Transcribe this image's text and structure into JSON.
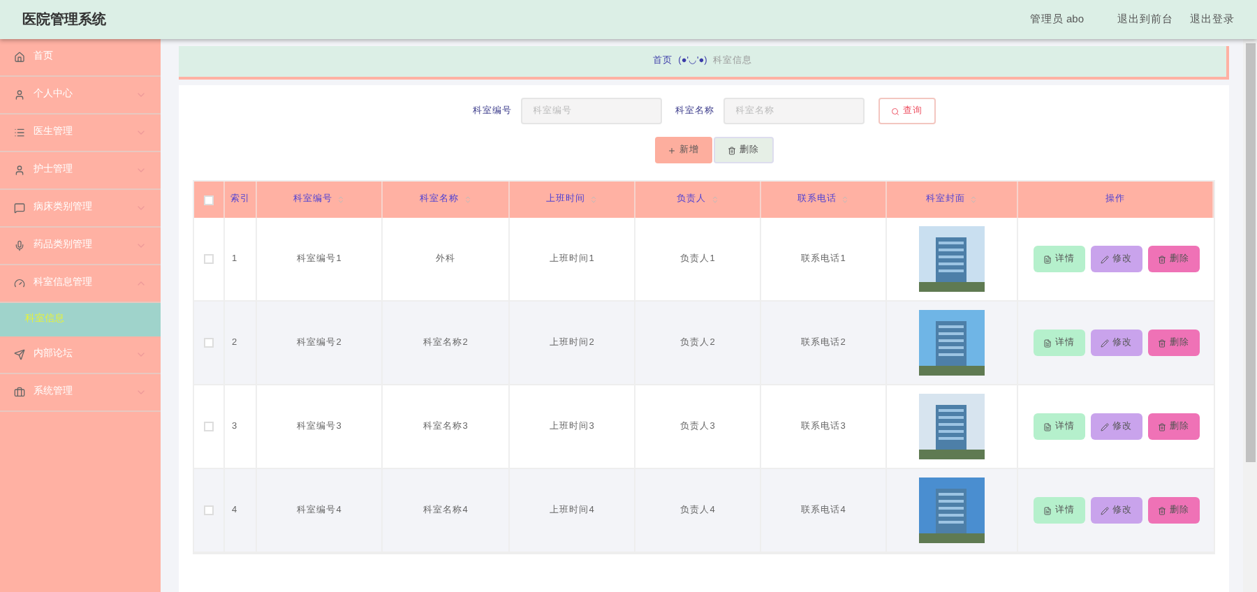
{
  "header": {
    "title": "医院管理系统",
    "user": "管理员 abo",
    "links": [
      "退出到前台",
      "退出登录"
    ]
  },
  "sidebar": {
    "items": [
      {
        "label": "首页",
        "has_arrow": false
      },
      {
        "label": "个人中心",
        "expanded": false,
        "has_arrow": true
      },
      {
        "label": "医生管理",
        "expanded": false,
        "has_arrow": true
      },
      {
        "label": "护士管理",
        "expanded": false,
        "has_arrow": true
      },
      {
        "label": "病床类别管理",
        "expanded": false,
        "has_arrow": true
      },
      {
        "label": "药品类别管理",
        "expanded": false,
        "has_arrow": true
      },
      {
        "label": "科室信息管理",
        "expanded": true,
        "has_arrow": true,
        "children": [
          {
            "label": "科室信息",
            "selected": true
          }
        ]
      },
      {
        "label": "内部论坛",
        "expanded": false,
        "has_arrow": true
      },
      {
        "label": "系统管理",
        "expanded": false,
        "has_arrow": true
      }
    ]
  },
  "breadcrumb": {
    "home": "首页",
    "separator": "(●'◡'●)",
    "current": "科室信息"
  },
  "search": {
    "fields": [
      {
        "label": "科室编号",
        "placeholder": "科室编号"
      },
      {
        "label": "科室名称",
        "placeholder": "科室名称"
      }
    ],
    "button": "查询"
  },
  "actions": {
    "add": "新增",
    "delete": "删除"
  },
  "table": {
    "columns": [
      {
        "label": "索引",
        "sortable": false
      },
      {
        "label": "科室编号",
        "sortable": true
      },
      {
        "label": "科室名称",
        "sortable": true
      },
      {
        "label": "上班时间",
        "sortable": true
      },
      {
        "label": "负责人",
        "sortable": true
      },
      {
        "label": "联系电话",
        "sortable": true
      },
      {
        "label": "科室封面",
        "sortable": true
      },
      {
        "label": "操作",
        "sortable": false
      }
    ],
    "select_all_checked": false,
    "rows": [
      {
        "index": "1",
        "code": "科室编号1",
        "name": "外科",
        "time": "上班时间1",
        "person": "负责人1",
        "phone": "联系电话1",
        "checked": false,
        "buttons": [
          "详情",
          "修改",
          "删除"
        ]
      },
      {
        "index": "2",
        "code": "科室编号2",
        "name": "科室名称2",
        "time": "上班时间2",
        "person": "负责人2",
        "phone": "联系电话2",
        "checked": false,
        "buttons": [
          "详情",
          "修改",
          "删除"
        ]
      },
      {
        "index": "3",
        "code": "科室编号3",
        "name": "科室名称3",
        "time": "上班时间3",
        "person": "负责人3",
        "phone": "联系电话3",
        "checked": false,
        "buttons": [
          "详情",
          "修改",
          "删除"
        ]
      },
      {
        "index": "4",
        "code": "科室编号4",
        "name": "科室名称4",
        "time": "上班时间4",
        "person": "负责人4",
        "phone": "联系电话4",
        "checked": false,
        "buttons": [
          "详情",
          "修改",
          "删除"
        ]
      }
    ]
  }
}
